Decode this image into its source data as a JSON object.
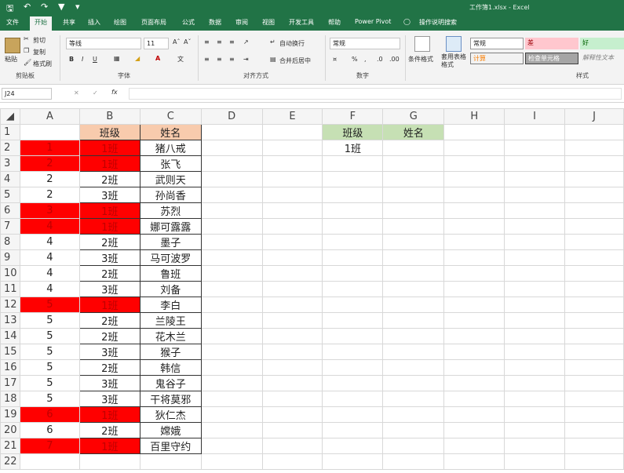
{
  "titlebar": {
    "title": "工作簿1.xlsx - Excel"
  },
  "tabs": [
    "文件",
    "开始",
    "共享",
    "插入",
    "绘图",
    "页面布局",
    "公式",
    "数据",
    "审阅",
    "视图",
    "开发工具",
    "帮助",
    "Power Pivot",
    "操作说明搜索"
  ],
  "clipboard": {
    "paste": "粘贴",
    "cut": "剪切",
    "copy": "复制",
    "painter": "格式刷",
    "group": "剪贴板"
  },
  "font": {
    "name": "等线",
    "size": "11",
    "group": "字体",
    "bold": "B",
    "italic": "I",
    "underline": "U"
  },
  "alignment": {
    "wrap": "自动换行",
    "merge": "合并后居中",
    "group": "对齐方式"
  },
  "number": {
    "format": "常规",
    "percent": "%",
    "group": "数字"
  },
  "styles": {
    "cond": "条件格式",
    "table": "套用表格格式",
    "normal": "常规",
    "bad": "差",
    "good": "好",
    "calc": "计算",
    "check": "检查单元格",
    "explain": "解释性文本",
    "group": "样式"
  },
  "formula": {
    "namebox": "J24",
    "fx": "fx",
    "value": ""
  },
  "columns": [
    "A",
    "B",
    "C",
    "D",
    "E",
    "F",
    "G",
    "H",
    "I",
    "J"
  ],
  "rows": [
    {
      "n": "1",
      "a": "",
      "b": "班级",
      "c": "姓名",
      "f": "班级",
      "g": "姓名"
    },
    {
      "n": "2",
      "a": "1",
      "b": "1班",
      "c": "猪八戒",
      "f": "1班",
      "g": ""
    },
    {
      "n": "3",
      "a": "2",
      "b": "1班",
      "c": "张飞",
      "f": "",
      "g": ""
    },
    {
      "n": "4",
      "a": "2",
      "b": "2班",
      "c": "武则天",
      "f": "",
      "g": ""
    },
    {
      "n": "5",
      "a": "2",
      "b": "3班",
      "c": "孙尚香",
      "f": "",
      "g": ""
    },
    {
      "n": "6",
      "a": "3",
      "b": "1班",
      "c": "苏烈",
      "f": "",
      "g": ""
    },
    {
      "n": "7",
      "a": "4",
      "b": "1班",
      "c": "娜可露露",
      "f": "",
      "g": ""
    },
    {
      "n": "8",
      "a": "4",
      "b": "2班",
      "c": "墨子",
      "f": "",
      "g": ""
    },
    {
      "n": "9",
      "a": "4",
      "b": "3班",
      "c": "马可波罗",
      "f": "",
      "g": ""
    },
    {
      "n": "10",
      "a": "4",
      "b": "2班",
      "c": "鲁班",
      "f": "",
      "g": ""
    },
    {
      "n": "11",
      "a": "4",
      "b": "3班",
      "c": "刘备",
      "f": "",
      "g": ""
    },
    {
      "n": "12",
      "a": "5",
      "b": "1班",
      "c": "李白",
      "f": "",
      "g": ""
    },
    {
      "n": "13",
      "a": "5",
      "b": "2班",
      "c": "兰陵王",
      "f": "",
      "g": ""
    },
    {
      "n": "14",
      "a": "5",
      "b": "2班",
      "c": "花木兰",
      "f": "",
      "g": ""
    },
    {
      "n": "15",
      "a": "5",
      "b": "3班",
      "c": "猴子",
      "f": "",
      "g": ""
    },
    {
      "n": "16",
      "a": "5",
      "b": "2班",
      "c": "韩信",
      "f": "",
      "g": ""
    },
    {
      "n": "17",
      "a": "5",
      "b": "3班",
      "c": "鬼谷子",
      "f": "",
      "g": ""
    },
    {
      "n": "18",
      "a": "5",
      "b": "3班",
      "c": "干将莫邪",
      "f": "",
      "g": ""
    },
    {
      "n": "19",
      "a": "6",
      "b": "1班",
      "c": "狄仁杰",
      "f": "",
      "g": ""
    },
    {
      "n": "20",
      "a": "6",
      "b": "2班",
      "c": "嫦娥",
      "f": "",
      "g": ""
    },
    {
      "n": "21",
      "a": "7",
      "b": "1班",
      "c": "百里守约",
      "f": "",
      "g": ""
    },
    {
      "n": "22",
      "a": "",
      "b": "",
      "c": "",
      "f": "",
      "g": ""
    }
  ],
  "highlighted_rows": [
    "2",
    "3",
    "6",
    "7",
    "12",
    "19",
    "21"
  ],
  "colors": {
    "accent": "#217346",
    "highlight": "#ff0000",
    "header_orange": "#f8cbad",
    "header_green": "#c6e0b4"
  }
}
